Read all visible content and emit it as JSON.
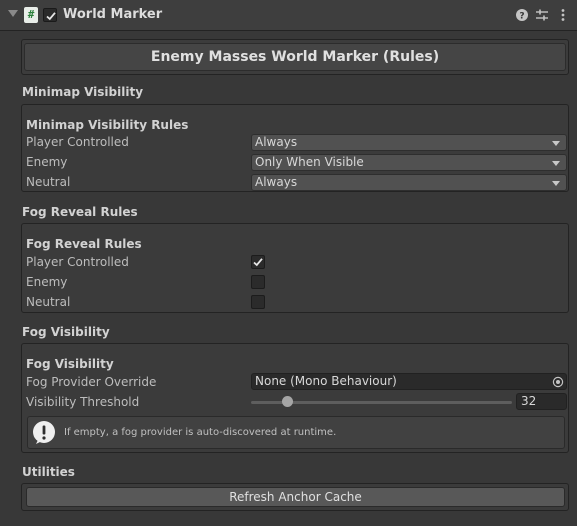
{
  "header": {
    "script_glyph": "#",
    "title": "World Marker",
    "enabled": true,
    "icons": [
      "help-icon",
      "presets-icon",
      "context-menu-icon"
    ]
  },
  "banner_button": {
    "label": "Enemy Masses World Marker (Rules)"
  },
  "minimap": {
    "section_title": "Minimap Visibility",
    "sub_title": "Minimap Visibility Rules",
    "rows": [
      {
        "label": "Player Controlled",
        "value": "Always"
      },
      {
        "label": "Enemy",
        "value": "Only When Visible"
      },
      {
        "label": "Neutral",
        "value": "Always"
      }
    ]
  },
  "fog_reveal": {
    "section_title": "Fog Reveal Rules",
    "sub_title": "Fog Reveal Rules",
    "rows": [
      {
        "label": "Player Controlled",
        "checked": true
      },
      {
        "label": "Enemy",
        "checked": false
      },
      {
        "label": "Neutral",
        "checked": false
      }
    ]
  },
  "fog_visibility": {
    "section_title": "Fog Visibility",
    "sub_title": "Fog Visibility",
    "provider_label": "Fog Provider Override",
    "provider_value": "None (Mono Behaviour)",
    "threshold_label": "Visibility Threshold",
    "threshold_value": "32",
    "threshold_fraction": 0.14,
    "help_text": "If empty, a fog provider is auto-discovered at runtime."
  },
  "utilities": {
    "section_title": "Utilities",
    "refresh_label": "Refresh Anchor Cache"
  },
  "colors": {
    "background": "#383838",
    "panel": "#3b3b3b",
    "field": "#515151",
    "button": "#585858"
  }
}
